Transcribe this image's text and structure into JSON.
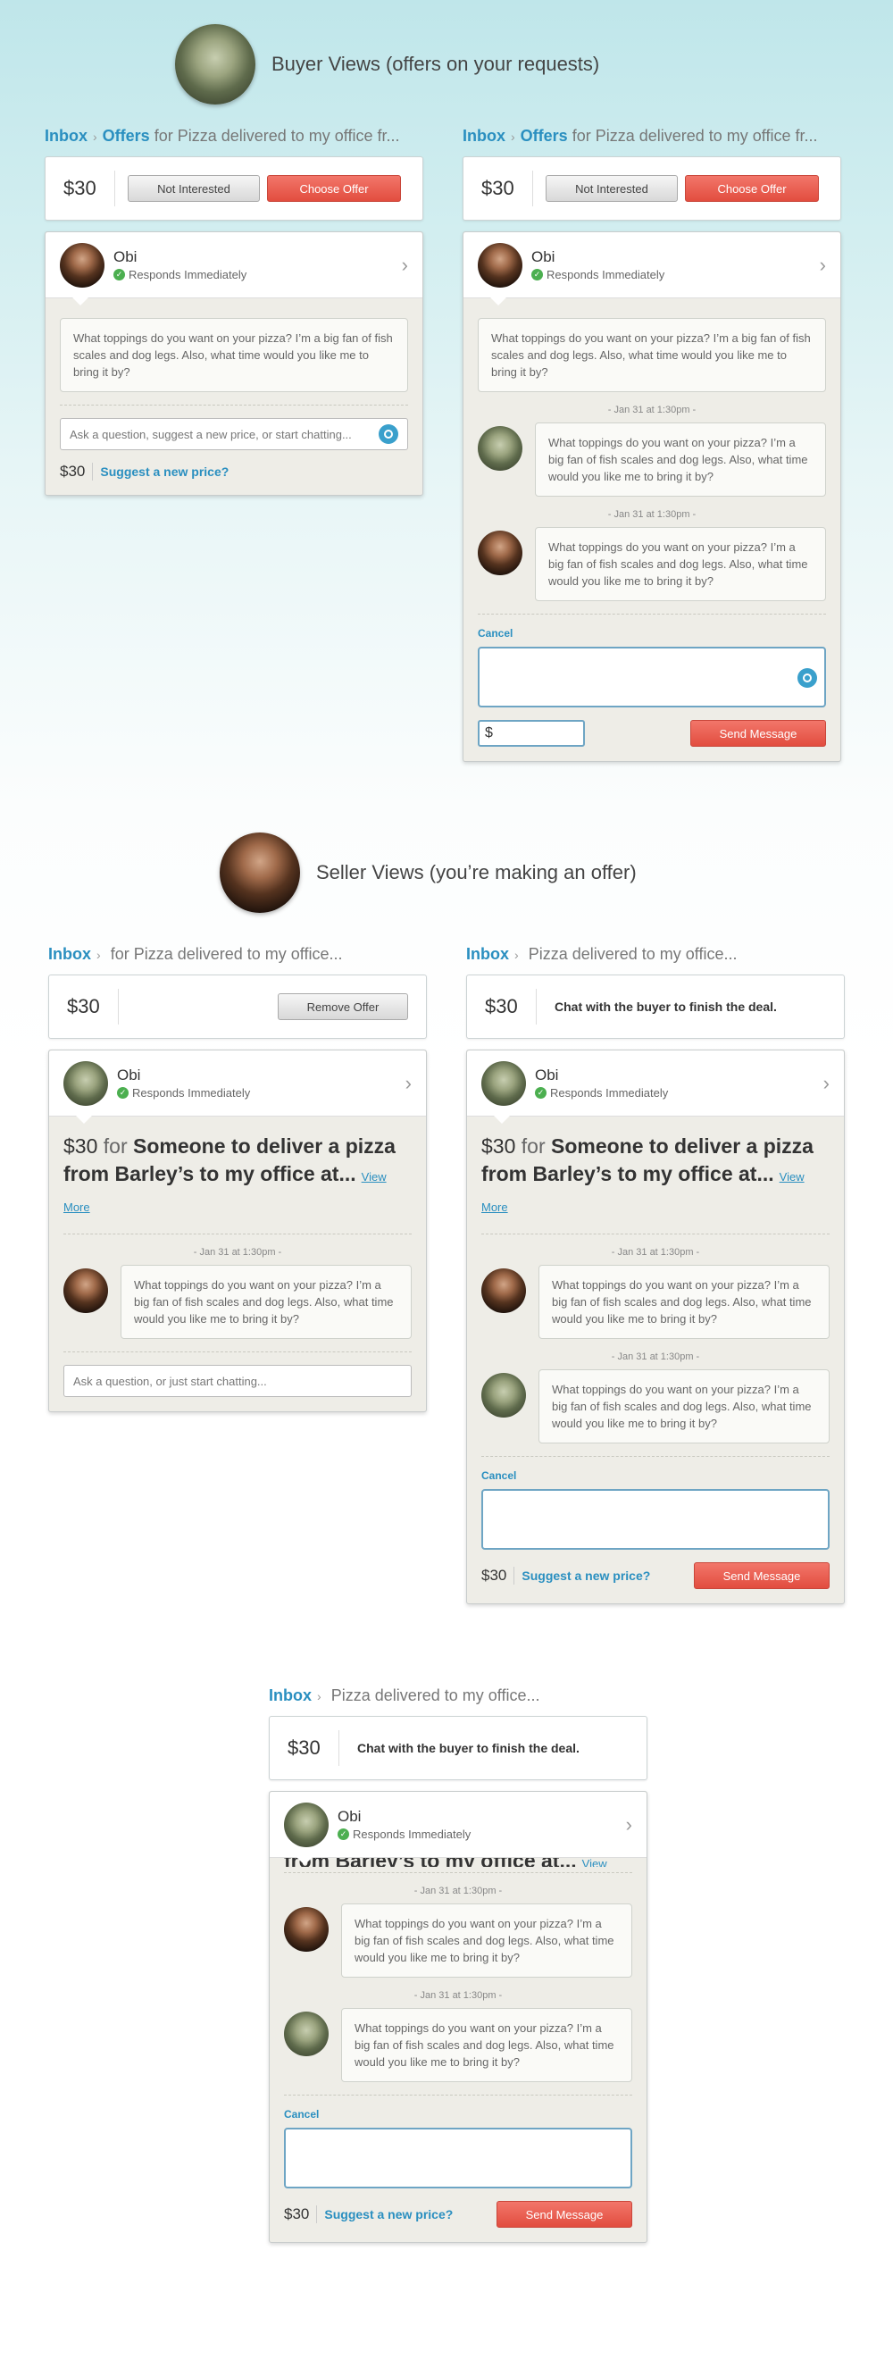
{
  "buyer_section": {
    "title": "Buyer Views (offers on your requests)"
  },
  "seller_section": {
    "title": "Seller Views (you’re making an offer)"
  },
  "common": {
    "inbox": "Inbox",
    "offers": "Offers",
    "price": "$30",
    "name": "Obi",
    "status": "Responds Immediately",
    "message": "What toppings do you want on your pizza? I’m a big fan of fish scales and dog legs. Also, what time would you like me to bring it by?",
    "timestamp": "- Jan 31 at 1:30pm -",
    "cancel": "Cancel",
    "send": "Send Message",
    "suggest": "Suggest a new price?",
    "dollar": "$",
    "chat_note": "Chat with the buyer to finish the deal."
  },
  "buyer1": {
    "crumb_rest": "for Pizza delivered to my office fr...",
    "not_interested": "Not Interested",
    "choose": "Choose Offer",
    "input_placeholder": "Ask a question, suggest a new price, or start chatting..."
  },
  "seller1": {
    "crumb_rest": "for Pizza delivered to my office...",
    "remove": "Remove Offer",
    "input_placeholder": "Ask a question, or just start chatting..."
  },
  "seller2": {
    "crumb_rest": "Pizza delivered to my office..."
  },
  "offer": {
    "for": "for",
    "line1": "Someone to deliver a pizza",
    "line2": "from Barley’s to my office at...",
    "partial": "from Barley’s to my office at...",
    "view_more": "View More"
  }
}
